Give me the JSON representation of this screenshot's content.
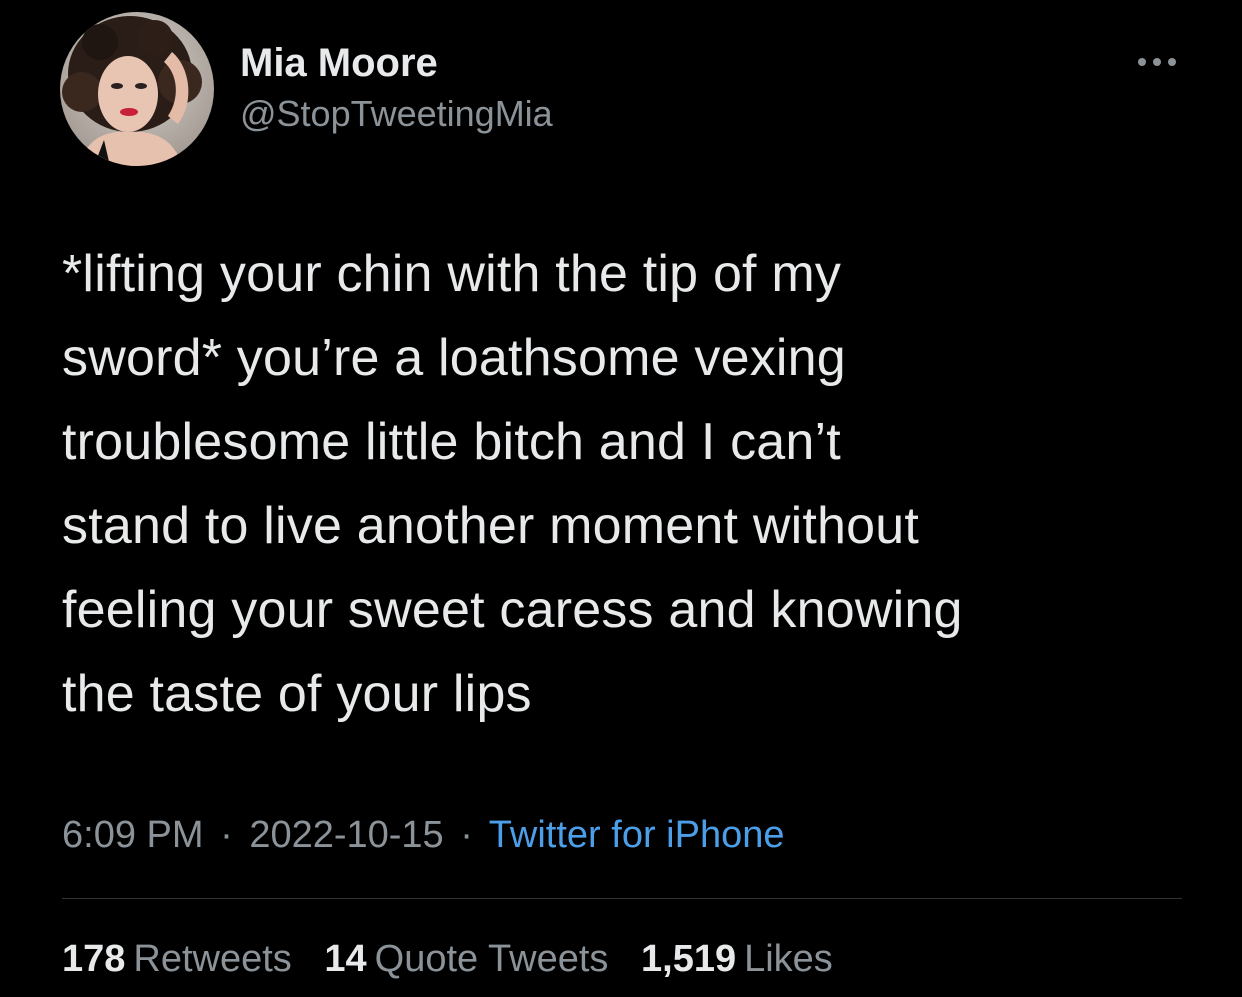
{
  "author": {
    "display_name": "Mia Moore",
    "handle": "@StopTweetingMia",
    "avatar_icon": "profile-photo"
  },
  "more_icon": "ellipsis-icon",
  "tweet": {
    "lines": [
      "*lifting your chin with the tip of my",
      "sword* you’re a loathsome vexing",
      "troublesome little bitch and I can’t",
      "stand to live another moment without",
      "feeling your sweet caress and knowing",
      "the taste of your lips"
    ]
  },
  "meta": {
    "time": "6:09 PM",
    "separator": "·",
    "date": "2022-10-15",
    "source": "Twitter for iPhone"
  },
  "stats": {
    "retweets": {
      "count": "178",
      "label": "Retweets"
    },
    "quotes": {
      "count": "14",
      "label": "Quote Tweets"
    },
    "likes": {
      "count": "1,519",
      "label": "Likes"
    }
  },
  "colors": {
    "background": "#000000",
    "text": "#e7e9ea",
    "muted": "#8b9399",
    "link": "#4c9ee8",
    "divider": "#2f3336"
  }
}
